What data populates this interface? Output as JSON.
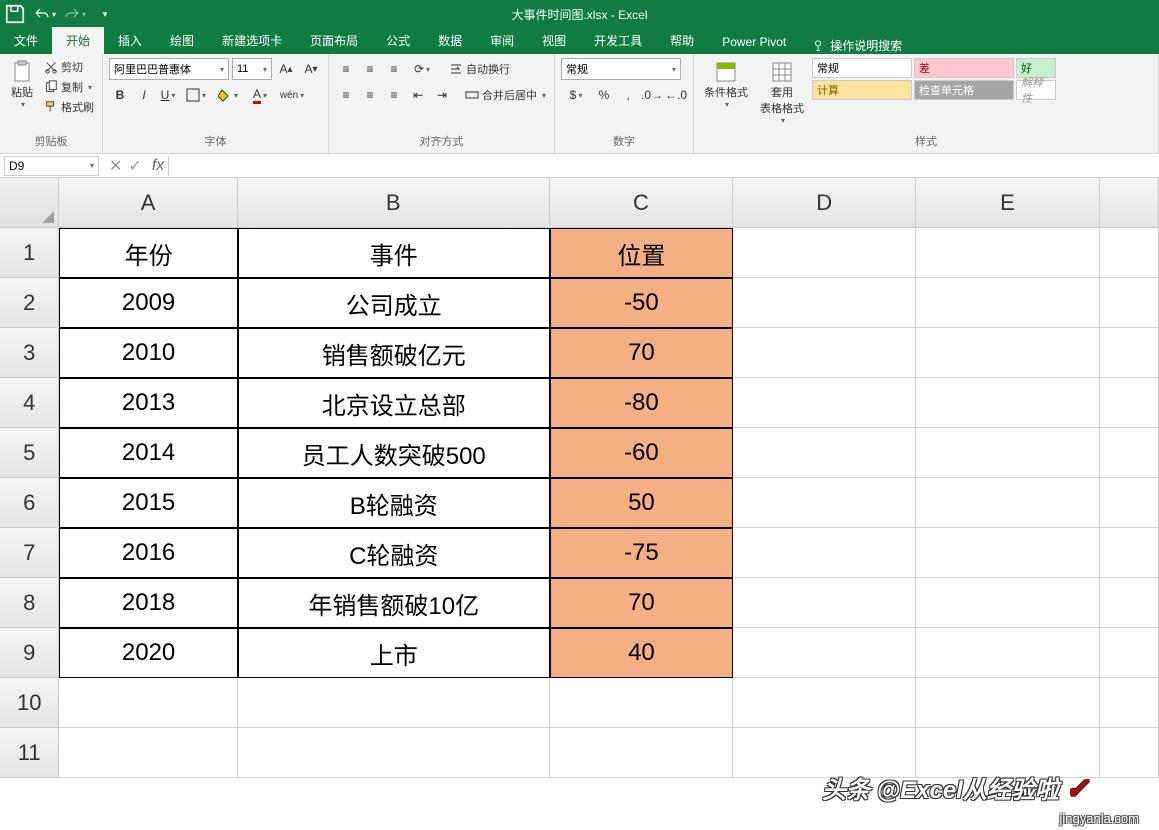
{
  "titlebar": {
    "filename": "大事件时间图.xlsx",
    "app": "Excel"
  },
  "tabs": {
    "file": "文件",
    "home": "开始",
    "insert": "插入",
    "draw": "绘图",
    "newtab": "新建选项卡",
    "layout": "页面布局",
    "formulas": "公式",
    "data": "数据",
    "review": "审阅",
    "view": "视图",
    "dev": "开发工具",
    "help": "帮助",
    "pivot": "Power Pivot",
    "tellme": "操作说明搜索"
  },
  "ribbon": {
    "clipboard": {
      "paste": "粘贴",
      "cut": "剪切",
      "copy": "复制",
      "format_painter": "格式刷",
      "label": "剪贴板"
    },
    "font": {
      "name": "阿里巴巴普惠体",
      "size": "11",
      "label": "字体"
    },
    "align": {
      "wrap": "自动换行",
      "merge": "合并后居中",
      "label": "对齐方式"
    },
    "number": {
      "format": "常规",
      "label": "数字"
    },
    "styles": {
      "cond": "条件格式",
      "table": "套用\n表格格式",
      "normal": "常规",
      "bad": "差",
      "good": "好",
      "calc": "计算",
      "check": "检查单元格",
      "explain": "解释性",
      "label": "样式"
    }
  },
  "namebox": "D9",
  "columns": [
    "A",
    "B",
    "C",
    "D",
    "E"
  ],
  "rows": [
    "1",
    "2",
    "3",
    "4",
    "5",
    "6",
    "7",
    "8",
    "9",
    "10",
    "11"
  ],
  "table": {
    "header": {
      "A": "年份",
      "B": "事件",
      "C": "位置"
    },
    "data": [
      {
        "A": "2009",
        "B": "公司成立",
        "C": "-50"
      },
      {
        "A": "2010",
        "B": "销售额破亿元",
        "C": "70"
      },
      {
        "A": "2013",
        "B": "北京设立总部",
        "C": "-80"
      },
      {
        "A": "2014",
        "B": "员工人数突破500",
        "C": "-60"
      },
      {
        "A": "2015",
        "B": "B轮融资",
        "C": "50"
      },
      {
        "A": "2016",
        "B": "C轮融资",
        "C": "-75"
      },
      {
        "A": "2018",
        "B": "年销售额破10亿",
        "C": "70"
      },
      {
        "A": "2020",
        "B": "上市",
        "C": "40"
      }
    ]
  },
  "watermark": {
    "main": "头条 @Excel从经验啦",
    "sub": "jingyanla.com"
  }
}
